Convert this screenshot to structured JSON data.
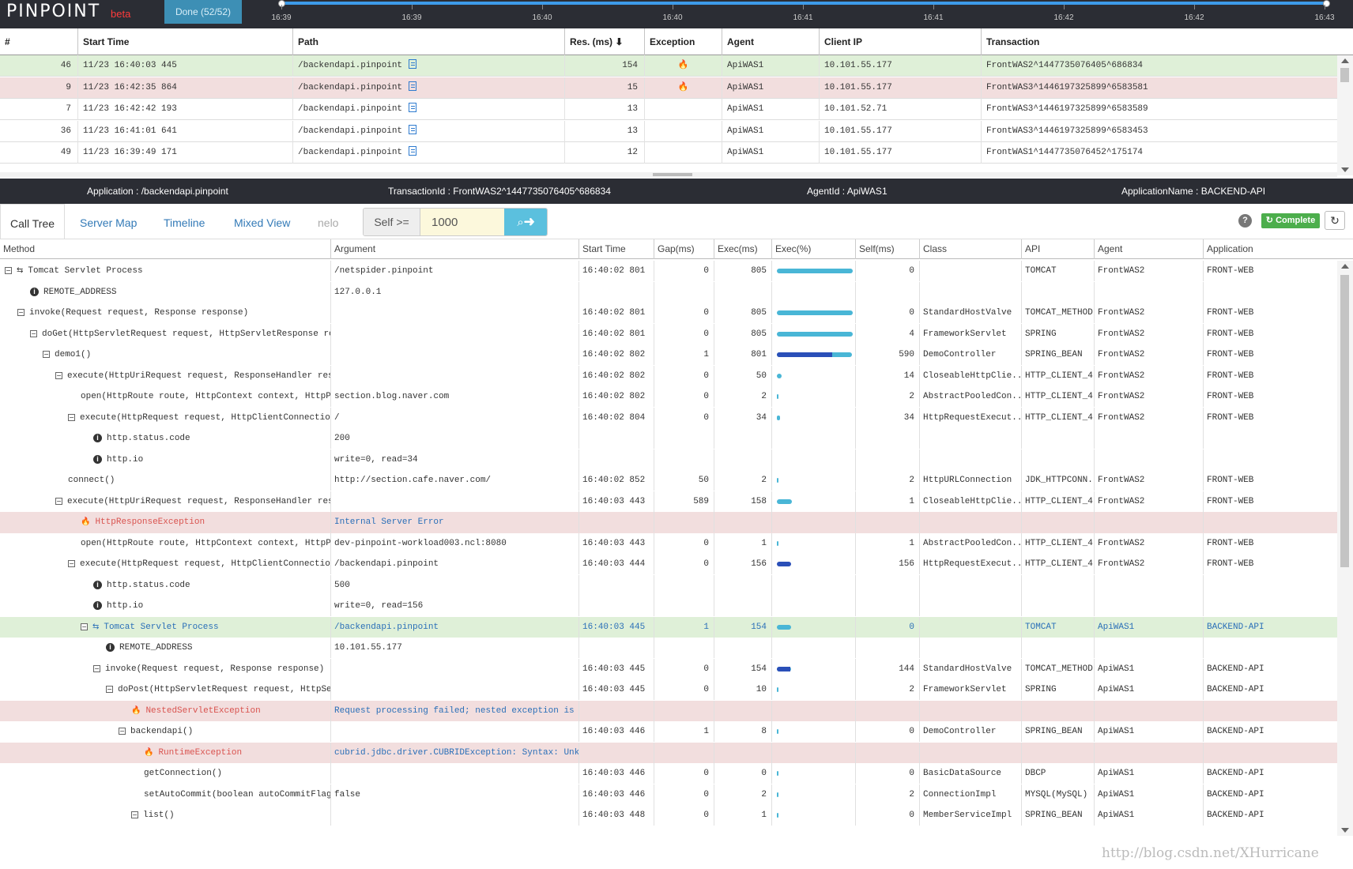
{
  "app": {
    "logo": "PINPOINT",
    "beta": "beta",
    "done_button": "Done (52/52)"
  },
  "timeline": {
    "ticks": [
      "16:39",
      "16:39",
      "16:40",
      "16:40",
      "16:41",
      "16:41",
      "16:42",
      "16:42",
      "16:43"
    ]
  },
  "tx_list": {
    "columns": [
      "#",
      "Start Time",
      "Path",
      "Res. (ms) ⬇",
      "Exception",
      "Agent",
      "Client IP",
      "Transaction"
    ],
    "rows": [
      {
        "num": "46",
        "start": "11/23 16:40:03 445",
        "path": "/backendapi.pinpoint",
        "res": "154",
        "exc": "🔥",
        "agent": "ApiWAS1",
        "ip": "10.101.55.177",
        "tx": "FrontWAS2^1447735076405^686834",
        "state": "sel"
      },
      {
        "num": "9",
        "start": "11/23 16:42:35 864",
        "path": "/backendapi.pinpoint",
        "res": "15",
        "exc": "🔥",
        "agent": "ApiWAS1",
        "ip": "10.101.55.177",
        "tx": "FrontWAS3^1446197325899^6583581",
        "state": "err"
      },
      {
        "num": "7",
        "start": "11/23 16:42:42 193",
        "path": "/backendapi.pinpoint",
        "res": "13",
        "exc": "",
        "agent": "ApiWAS1",
        "ip": "10.101.52.71",
        "tx": "FrontWAS3^1446197325899^6583589",
        "state": ""
      },
      {
        "num": "36",
        "start": "11/23 16:41:01 641",
        "path": "/backendapi.pinpoint",
        "res": "13",
        "exc": "",
        "agent": "ApiWAS1",
        "ip": "10.101.55.177",
        "tx": "FrontWAS3^1446197325899^6583453",
        "state": ""
      },
      {
        "num": "49",
        "start": "11/23 16:39:49 171",
        "path": "/backendapi.pinpoint",
        "res": "12",
        "exc": "",
        "agent": "ApiWAS1",
        "ip": "10.101.55.177",
        "tx": "FrontWAS1^1447735076452^175174",
        "state": ""
      }
    ]
  },
  "info_bar": {
    "application": "Application : /backendapi.pinpoint",
    "transaction_id": "TransactionId : FrontWAS2^1447735076405^686834",
    "agent_id": "AgentId : ApiWAS1",
    "application_name": "ApplicationName : BACKEND-API"
  },
  "tabs": {
    "call_tree": "Call Tree",
    "server_map": "Server Map",
    "timeline": "Timeline",
    "mixed_view": "Mixed View",
    "nelo": "nelo",
    "self_label": "Self >=",
    "self_value": "1000",
    "help": "?",
    "complete": "Complete",
    "refresh_icon": "refresh-icon"
  },
  "call_tree": {
    "columns": [
      "Method",
      "Argument",
      "Start Time",
      "Gap(ms)",
      "Exec(ms)",
      "Exec(%)",
      "Self(ms)",
      "Class",
      "API",
      "Agent",
      "Application"
    ],
    "rows": [
      {
        "indent": 0,
        "icon": "toggle-svc",
        "method": "Tomcat Servlet Process",
        "arg": "/netspider.pinpoint",
        "start": "16:40:02 801",
        "gap": "0",
        "exec": "805",
        "pct": 100,
        "self_pct": 0,
        "self": "0",
        "cls": "",
        "api": "TOMCAT",
        "agent": "FrontWAS2",
        "app": "FRONT-WEB",
        "state": ""
      },
      {
        "indent": 2,
        "icon": "info",
        "method": "REMOTE_ADDRESS",
        "arg": "127.0.0.1",
        "start": "",
        "gap": "",
        "exec": "",
        "pct": null,
        "self_pct": 0,
        "self": "",
        "cls": "",
        "api": "",
        "agent": "",
        "app": "",
        "state": ""
      },
      {
        "indent": 1,
        "icon": "toggle",
        "method": "invoke(Request request, Response response)",
        "arg": "",
        "start": "16:40:02 801",
        "gap": "0",
        "exec": "805",
        "pct": 100,
        "self_pct": 0,
        "self": "0",
        "cls": "StandardHostValve",
        "api": "TOMCAT_METHOD",
        "agent": "FrontWAS2",
        "app": "FRONT-WEB",
        "state": ""
      },
      {
        "indent": 2,
        "icon": "toggle",
        "method": "doGet(HttpServletRequest request, HttpServletResponse res",
        "arg": "",
        "start": "16:40:02 801",
        "gap": "0",
        "exec": "805",
        "pct": 100,
        "self_pct": 0,
        "self": "4",
        "cls": "FrameworkServlet",
        "api": "SPRING",
        "agent": "FrontWAS2",
        "app": "FRONT-WEB",
        "state": ""
      },
      {
        "indent": 3,
        "icon": "toggle",
        "method": "demo1()",
        "arg": "",
        "start": "16:40:02 802",
        "gap": "1",
        "exec": "801",
        "pct": 99,
        "self_pct": 73,
        "self": "590",
        "cls": "DemoController",
        "api": "SPRING_BEAN",
        "agent": "FrontWAS2",
        "app": "FRONT-WEB",
        "state": ""
      },
      {
        "indent": 4,
        "icon": "toggle",
        "method": "execute(HttpUriRequest request, ResponseHandler resp",
        "arg": "",
        "start": "16:40:02 802",
        "gap": "0",
        "exec": "50",
        "pct": 6,
        "self_pct": 0,
        "self": "14",
        "cls": "CloseableHttpClie...",
        "api": "HTTP_CLIENT_4",
        "agent": "FrontWAS2",
        "app": "FRONT-WEB",
        "state": ""
      },
      {
        "indent": 6,
        "icon": "",
        "method": "open(HttpRoute route, HttpContext context, HttpPa",
        "arg": "section.blog.naver.com",
        "start": "16:40:02 802",
        "gap": "0",
        "exec": "2",
        "pct": 1,
        "self_pct": 0,
        "self": "2",
        "cls": "AbstractPooledCon...",
        "api": "HTTP_CLIENT_4",
        "agent": "FrontWAS2",
        "app": "FRONT-WEB",
        "state": ""
      },
      {
        "indent": 5,
        "icon": "toggle",
        "method": "execute(HttpRequest request, HttpClientConnection",
        "arg": "/",
        "start": "16:40:02 804",
        "gap": "0",
        "exec": "34",
        "pct": 4,
        "self_pct": 0,
        "self": "34",
        "cls": "HttpRequestExecut...",
        "api": "HTTP_CLIENT_4",
        "agent": "FrontWAS2",
        "app": "FRONT-WEB",
        "state": ""
      },
      {
        "indent": 7,
        "icon": "info",
        "method": "http.status.code",
        "arg": "200",
        "start": "",
        "gap": "",
        "exec": "",
        "pct": null,
        "self_pct": 0,
        "self": "",
        "cls": "",
        "api": "",
        "agent": "",
        "app": "",
        "state": ""
      },
      {
        "indent": 7,
        "icon": "info",
        "method": "http.io",
        "arg": "write=0, read=34",
        "start": "",
        "gap": "",
        "exec": "",
        "pct": null,
        "self_pct": 0,
        "self": "",
        "cls": "",
        "api": "",
        "agent": "",
        "app": "",
        "state": ""
      },
      {
        "indent": 5,
        "icon": "",
        "method": "connect()",
        "arg": "http://section.cafe.naver.com/",
        "start": "16:40:02 852",
        "gap": "50",
        "exec": "2",
        "pct": 1,
        "self_pct": 0,
        "self": "2",
        "cls": "HttpURLConnection",
        "api": "JDK_HTTPCONN...",
        "agent": "FrontWAS2",
        "app": "FRONT-WEB",
        "state": ""
      },
      {
        "indent": 4,
        "icon": "toggle",
        "method": "execute(HttpUriRequest request, ResponseHandler resp",
        "arg": "",
        "start": "16:40:03 443",
        "gap": "589",
        "exec": "158",
        "pct": 20,
        "self_pct": 0,
        "self": "1",
        "cls": "CloseableHttpClie...",
        "api": "HTTP_CLIENT_4",
        "agent": "FrontWAS2",
        "app": "FRONT-WEB",
        "state": ""
      },
      {
        "indent": 6,
        "icon": "fire",
        "method": "HttpResponseException",
        "arg": "Internal Server Error",
        "start": "",
        "gap": "",
        "exec": "",
        "pct": null,
        "self_pct": 0,
        "self": "",
        "cls": "",
        "api": "",
        "agent": "",
        "app": "",
        "state": "err"
      },
      {
        "indent": 6,
        "icon": "",
        "method": "open(HttpRoute route, HttpContext context, HttpPa",
        "arg": "dev-pinpoint-workload003.ncl:8080",
        "start": "16:40:03 443",
        "gap": "0",
        "exec": "1",
        "pct": 1,
        "self_pct": 0,
        "self": "1",
        "cls": "AbstractPooledCon...",
        "api": "HTTP_CLIENT_4",
        "agent": "FrontWAS2",
        "app": "FRONT-WEB",
        "state": ""
      },
      {
        "indent": 5,
        "icon": "toggle",
        "method": "execute(HttpRequest request, HttpClientConnection",
        "arg": "/backendapi.pinpoint",
        "start": "16:40:03 444",
        "gap": "0",
        "exec": "156",
        "pct": 19,
        "self_pct": 19,
        "self": "156",
        "cls": "HttpRequestExecut...",
        "api": "HTTP_CLIENT_4",
        "agent": "FrontWAS2",
        "app": "FRONT-WEB",
        "state": ""
      },
      {
        "indent": 7,
        "icon": "info",
        "method": "http.status.code",
        "arg": "500",
        "start": "",
        "gap": "",
        "exec": "",
        "pct": null,
        "self_pct": 0,
        "self": "",
        "cls": "",
        "api": "",
        "agent": "",
        "app": "",
        "state": ""
      },
      {
        "indent": 7,
        "icon": "info",
        "method": "http.io",
        "arg": "write=0, read=156",
        "start": "",
        "gap": "",
        "exec": "",
        "pct": null,
        "self_pct": 0,
        "self": "",
        "cls": "",
        "api": "",
        "agent": "",
        "app": "",
        "state": ""
      },
      {
        "indent": 6,
        "icon": "toggle-svc",
        "method": "Tomcat Servlet Process",
        "arg": "/backendapi.pinpoint",
        "start": "16:40:03 445",
        "gap": "1",
        "exec": "154",
        "pct": 19,
        "self_pct": 0,
        "self": "0",
        "cls": "",
        "api": "TOMCAT",
        "agent": "ApiWAS1",
        "app": "BACKEND-API",
        "state": "sel"
      },
      {
        "indent": 8,
        "icon": "info",
        "method": "REMOTE_ADDRESS",
        "arg": "10.101.55.177",
        "start": "",
        "gap": "",
        "exec": "",
        "pct": null,
        "self_pct": 0,
        "self": "",
        "cls": "",
        "api": "",
        "agent": "",
        "app": "",
        "state": ""
      },
      {
        "indent": 7,
        "icon": "toggle",
        "method": "invoke(Request request, Response response)",
        "arg": "",
        "start": "16:40:03 445",
        "gap": "0",
        "exec": "154",
        "pct": 19,
        "self_pct": 18,
        "self": "144",
        "cls": "StandardHostValve",
        "api": "TOMCAT_METHOD",
        "agent": "ApiWAS1",
        "app": "BACKEND-API",
        "state": ""
      },
      {
        "indent": 8,
        "icon": "toggle",
        "method": "doPost(HttpServletRequest request, HttpSer",
        "arg": "",
        "start": "16:40:03 445",
        "gap": "0",
        "exec": "10",
        "pct": 1,
        "self_pct": 0,
        "self": "2",
        "cls": "FrameworkServlet",
        "api": "SPRING",
        "agent": "ApiWAS1",
        "app": "BACKEND-API",
        "state": ""
      },
      {
        "indent": 10,
        "icon": "fire",
        "method": "NestedServletException",
        "arg": "Request processing failed; nested exception is ja",
        "start": "",
        "gap": "",
        "exec": "",
        "pct": null,
        "self_pct": 0,
        "self": "",
        "cls": "",
        "api": "",
        "agent": "",
        "app": "",
        "state": "err"
      },
      {
        "indent": 9,
        "icon": "toggle",
        "method": "backendapi()",
        "arg": "",
        "start": "16:40:03 446",
        "gap": "1",
        "exec": "8",
        "pct": 1,
        "self_pct": 0,
        "self": "0",
        "cls": "DemoController",
        "api": "SPRING_BEAN",
        "agent": "ApiWAS1",
        "app": "BACKEND-API",
        "state": ""
      },
      {
        "indent": 11,
        "icon": "fire",
        "method": "RuntimeException",
        "arg": "cubrid.jdbc.driver.CUBRIDException: Syntax: Unknc",
        "start": "",
        "gap": "",
        "exec": "",
        "pct": null,
        "self_pct": 0,
        "self": "",
        "cls": "",
        "api": "",
        "agent": "",
        "app": "",
        "state": "err"
      },
      {
        "indent": 11,
        "icon": "",
        "method": "getConnection()",
        "arg": "",
        "start": "16:40:03 446",
        "gap": "0",
        "exec": "0",
        "pct": 0.5,
        "self_pct": 0,
        "self": "0",
        "cls": "BasicDataSource",
        "api": "DBCP",
        "agent": "ApiWAS1",
        "app": "BACKEND-API",
        "state": ""
      },
      {
        "indent": 11,
        "icon": "",
        "method": "setAutoCommit(boolean autoCommitFlag)",
        "arg": "false",
        "start": "16:40:03 446",
        "gap": "0",
        "exec": "2",
        "pct": 1,
        "self_pct": 0,
        "self": "2",
        "cls": "ConnectionImpl",
        "api": "MYSQL(MySQL)",
        "agent": "ApiWAS1",
        "app": "BACKEND-API",
        "state": ""
      },
      {
        "indent": 10,
        "icon": "toggle",
        "method": "list()",
        "arg": "",
        "start": "16:40:03 448",
        "gap": "0",
        "exec": "1",
        "pct": 1,
        "self_pct": 0,
        "self": "0",
        "cls": "MemberServiceImpl",
        "api": "SPRING_BEAN",
        "agent": "ApiWAS1",
        "app": "BACKEND-API",
        "state": ""
      }
    ]
  },
  "watermark": "http://blog.csdn.net/XHurricane",
  "colors": {
    "topbar": "#2b2d34",
    "selected_row": "#dff0d8",
    "error_row": "#f2dede",
    "exec_bar": "#49b6d6",
    "self_bar": "#2a4fb8",
    "complete": "#4cae4c"
  }
}
